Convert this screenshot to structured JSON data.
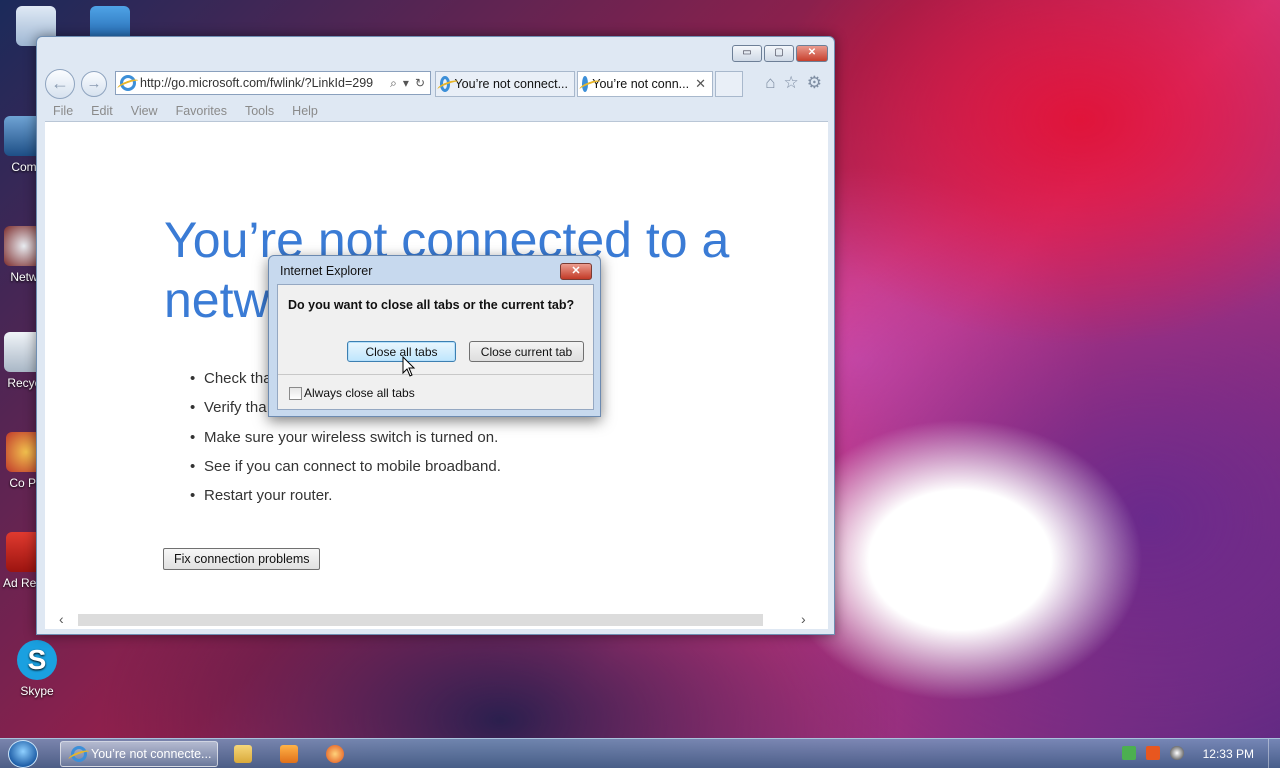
{
  "desktop": {
    "icons": [
      {
        "label": ""
      },
      {
        "label": ""
      },
      {
        "label": "Com"
      },
      {
        "label": "Netw"
      },
      {
        "label": "Recyc"
      },
      {
        "label": "Co Pa"
      },
      {
        "label": "Ad Reac"
      },
      {
        "label": "Skype"
      }
    ]
  },
  "window": {
    "caption": {
      "minimize": "▭",
      "maximize": "▢",
      "close": "✕"
    },
    "nav": {
      "back": "←",
      "forward": "→"
    },
    "address": "http://go.microsoft.com/fwlink/?LinkId=299",
    "address_tools": [
      "⌕",
      "▾",
      "↻"
    ],
    "tabs": [
      {
        "title": "You’re not connect..."
      },
      {
        "title": "You’re not conn...",
        "close": "✕"
      }
    ],
    "toolbar_icons": [
      "⌂",
      "☆",
      "⚙"
    ],
    "menu": [
      "File",
      "Edit",
      "View",
      "Favorites",
      "Tools",
      "Help"
    ],
    "content": {
      "headline_line1": "You’re not connected to a",
      "headline_line2": "netw",
      "bullets": [
        "Check tha",
        "Verify tha",
        "Make sure your wireless switch is turned on.",
        "See if you can connect to mobile broadband.",
        "Restart your router."
      ],
      "fix_button": "Fix connection problems"
    },
    "scroll": {
      "left": "‹",
      "right": "›"
    }
  },
  "dialog": {
    "title": "Internet Explorer",
    "close": "✕",
    "question": "Do you want to close all tabs or the current tab?",
    "close_all": "Close all tabs",
    "close_current": "Close current tab",
    "checkbox_label": "Always close all tabs",
    "checkbox_checked": false
  },
  "taskbar": {
    "active_task": "You’re not connecte...",
    "clock": "12:33 PM"
  }
}
